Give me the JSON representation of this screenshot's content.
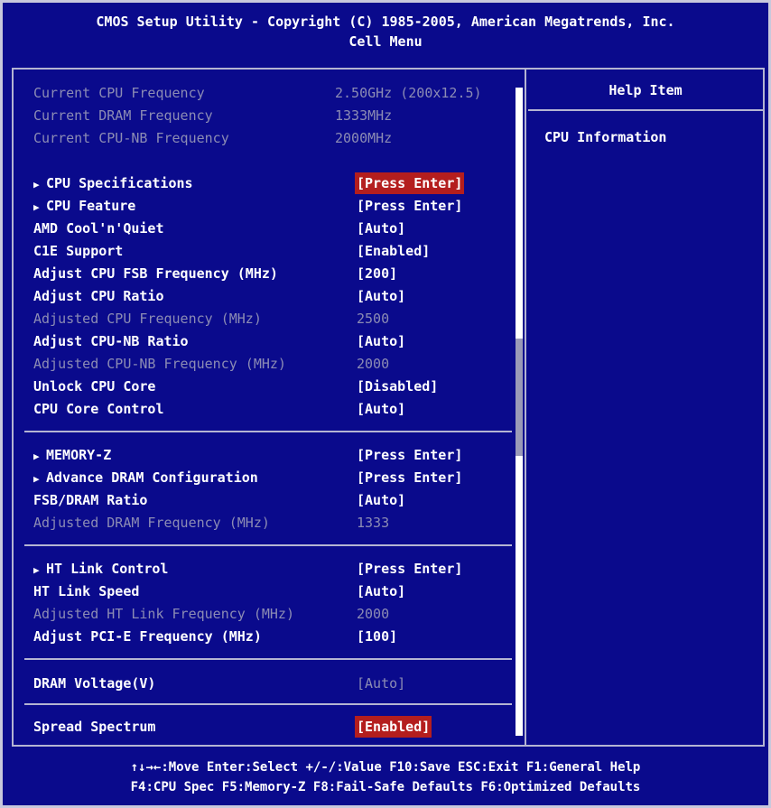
{
  "title": {
    "line1": "CMOS Setup Utility - Copyright (C) 1985-2005, American Megatrends, Inc.",
    "line2": "Cell Menu"
  },
  "help": {
    "title": "Help Item",
    "text": "CPU Information"
  },
  "info_rows": [
    {
      "label": "Current CPU Frequency",
      "value": "2.50GHz (200x12.5)"
    },
    {
      "label": "Current DRAM Frequency",
      "value": "1333MHz"
    },
    {
      "label": "Current CPU-NB Frequency",
      "value": "2000MHz"
    }
  ],
  "settings": {
    "cpu_specifications": {
      "label": "CPU Specifications",
      "value": "[Press Enter]"
    },
    "cpu_feature": {
      "label": "CPU Feature",
      "value": "[Press Enter]"
    },
    "cool_n_quiet": {
      "label": "AMD Cool'n'Quiet",
      "value": "[Auto]"
    },
    "c1e_support": {
      "label": "C1E Support",
      "value": "[Enabled]"
    },
    "cpu_fsb": {
      "label": "Adjust CPU FSB Frequency (MHz)",
      "value": "[200]"
    },
    "cpu_ratio": {
      "label": "Adjust CPU Ratio",
      "value": "[Auto]"
    },
    "adjusted_cpu_freq": {
      "label": "Adjusted CPU Frequency (MHz)",
      "value": "2500"
    },
    "cpu_nb_ratio": {
      "label": "Adjust CPU-NB Ratio",
      "value": "[Auto]"
    },
    "adjusted_cpu_nb_freq": {
      "label": "Adjusted CPU-NB Frequency (MHz)",
      "value": "2000"
    },
    "unlock_cpu_core": {
      "label": "Unlock CPU Core",
      "value": "[Disabled]"
    },
    "cpu_core_control": {
      "label": "CPU Core Control",
      "value": "[Auto]"
    },
    "memory_z": {
      "label": "MEMORY-Z",
      "value": "[Press Enter]"
    },
    "advance_dram": {
      "label": "Advance DRAM Configuration",
      "value": "[Press Enter]"
    },
    "fsb_dram_ratio": {
      "label": "FSB/DRAM Ratio",
      "value": "[Auto]"
    },
    "adjusted_dram_freq": {
      "label": "Adjusted DRAM Frequency (MHz)",
      "value": "1333"
    },
    "ht_link_control": {
      "label": "HT Link Control",
      "value": "[Press Enter]"
    },
    "ht_link_speed": {
      "label": "HT Link Speed",
      "value": "[Auto]"
    },
    "adjusted_ht_link_freq": {
      "label": "Adjusted HT Link Frequency (MHz)",
      "value": "2000"
    },
    "pcie_freq": {
      "label": "Adjust PCI-E Frequency (MHz)",
      "value": "[100]"
    },
    "dram_voltage": {
      "label": "DRAM Voltage(V)",
      "value": "[Auto]"
    },
    "spread_spectrum": {
      "label": "Spread Spectrum",
      "value": "[Enabled]"
    }
  },
  "footer": {
    "line1": "↑↓→←:Move  Enter:Select  +/-/:Value  F10:Save  ESC:Exit  F1:General Help",
    "line2": "F4:CPU Spec  F5:Memory-Z  F8:Fail-Safe Defaults    F6:Optimized Defaults"
  },
  "colors": {
    "background": "#0a0a8c",
    "highlight": "#b41e1e",
    "disabled_text": "#8c8cb4",
    "border": "#b4b4d2"
  },
  "icons": {
    "submenu": "right-triangle-icon",
    "scroll_up": "up-triangle-icon",
    "scroll_down": "down-triangle-icon"
  }
}
